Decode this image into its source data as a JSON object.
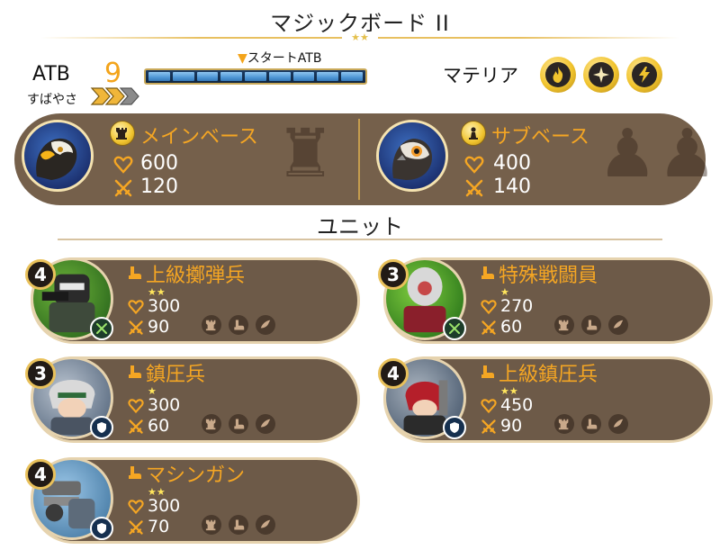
{
  "header": {
    "title": "マジックボード II",
    "stars": "★★"
  },
  "atb": {
    "label": "ATB",
    "value": "9",
    "speed_label": "すばやさ",
    "start_label": "スタートATB",
    "segments": 9
  },
  "materia": {
    "label": "マテリア",
    "items": [
      {
        "icon": "fire-icon"
      },
      {
        "icon": "star-burst-icon"
      },
      {
        "icon": "lightning-icon"
      }
    ]
  },
  "bases": {
    "main": {
      "name": "メインベース",
      "hp": "600",
      "atk": "120",
      "icon": "rook-icon"
    },
    "sub": {
      "name": "サブベース",
      "hp": "400",
      "atk": "140",
      "icon": "pawn-icon"
    }
  },
  "units_heading": "ユニット",
  "units": [
    {
      "level": "4",
      "name": "上級擲弾兵",
      "stars": "★★",
      "hp": "300",
      "atk": "90",
      "class_icon": "crossed-swords-icon"
    },
    {
      "level": "3",
      "name": "特殊戦闘員",
      "stars": "★",
      "hp": "270",
      "atk": "60",
      "class_icon": "crossed-swords-icon"
    },
    {
      "level": "3",
      "name": "鎮圧兵",
      "stars": "★",
      "hp": "300",
      "atk": "60",
      "class_icon": "shield-icon"
    },
    {
      "level": "4",
      "name": "上級鎮圧兵",
      "stars": "★★",
      "hp": "450",
      "atk": "90",
      "class_icon": "shield-icon"
    },
    {
      "level": "4",
      "name": "マシンガン",
      "stars": "★★",
      "hp": "300",
      "atk": "70",
      "class_icon": "shield-icon"
    }
  ],
  "colors": {
    "accent": "#f5a623",
    "panel": "#75604b",
    "card": "#6d5a48",
    "gold": "#f1c42e"
  }
}
